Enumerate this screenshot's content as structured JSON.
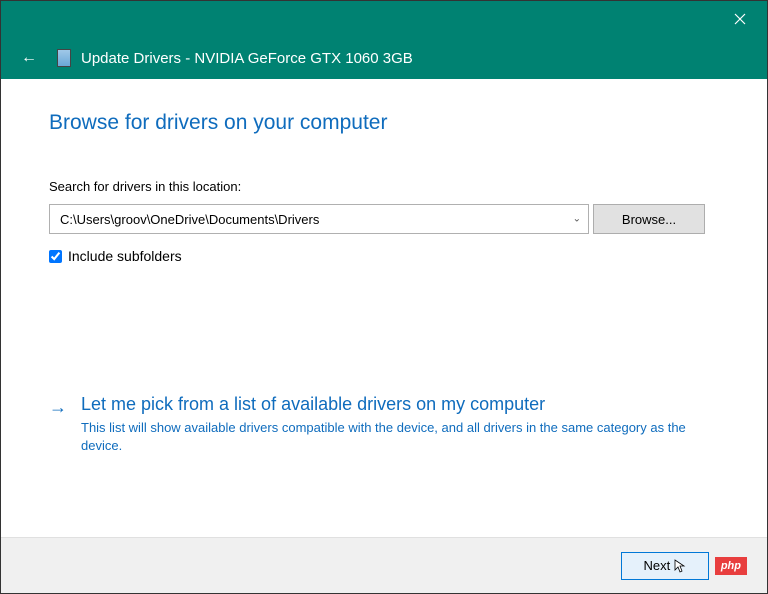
{
  "titlebar": {
    "close_label": "Close"
  },
  "header": {
    "back_label": "Back",
    "title": "Update Drivers - NVIDIA GeForce GTX 1060 3GB"
  },
  "content": {
    "heading": "Browse for drivers on your computer",
    "search_label": "Search for drivers in this location:",
    "path_value": "C:\\Users\\groov\\OneDrive\\Documents\\Drivers",
    "browse_label": "Browse...",
    "include_subfolders_label": "Include subfolders",
    "include_subfolders_checked": true
  },
  "pick_option": {
    "title": "Let me pick from a list of available drivers on my computer",
    "description": "This list will show available drivers compatible with the device, and all drivers in the same category as the device."
  },
  "buttons": {
    "next_label": "Next"
  },
  "watermark": {
    "text": "php"
  }
}
